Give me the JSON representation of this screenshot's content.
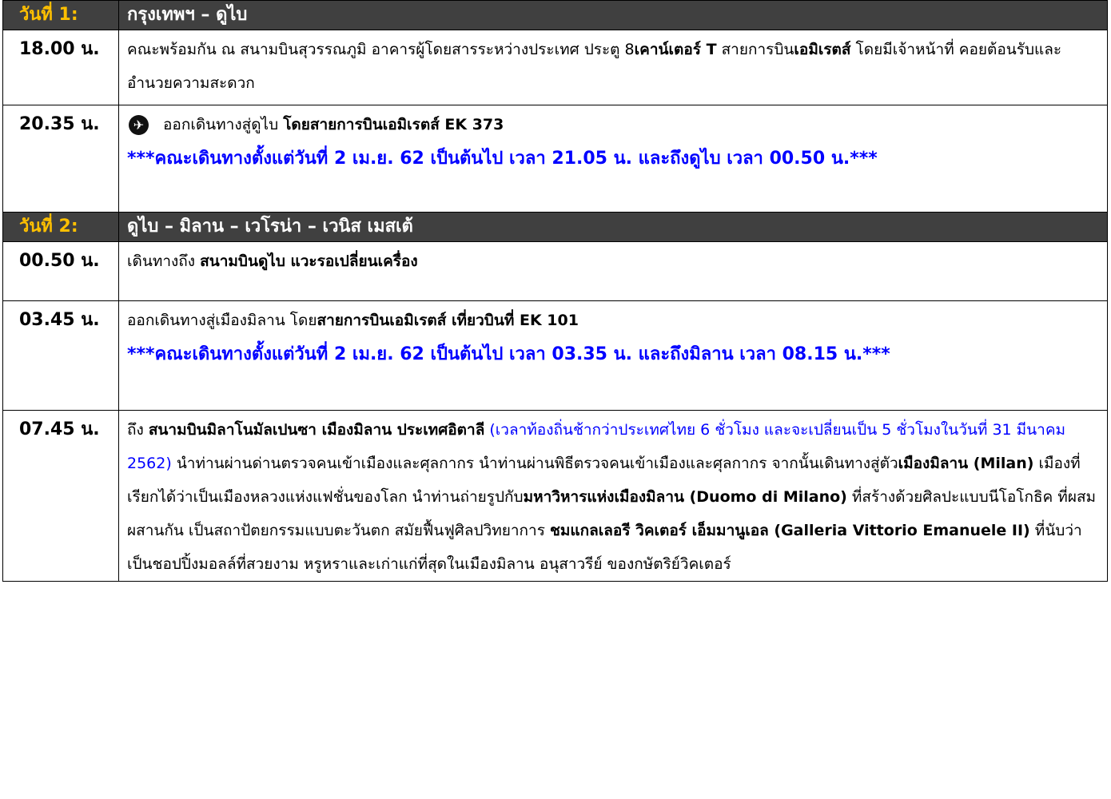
{
  "days": [
    {
      "label": "วันที่ 1:",
      "title": "กรุงเทพฯ – ดูไบ",
      "rows": [
        {
          "time": "18.00 น.",
          "parts": [
            "คณะพร้อมกัน ณ สนามบินสุวรรณภูมิ อาคารผู้โดยสารระหว่างประเทศ ประตู 8",
            "เคาน์เตอร์ T",
            " สายการบิน",
            "เอมิเรตส์",
            " โดยมีเจ้าหน้าที่ คอยต้อนรับและอำนวยความสะดวก"
          ]
        },
        {
          "time": "20.35 น.",
          "icon": "airplane-departure-icon",
          "parts": [
            "ออกเดินทางสู่ดูไบ ",
            "โดยสายการบินเอมิเรตส์ EK 373"
          ],
          "notice": "***คณะเดินทางตั้งแต่วันที่ 2 เม.ย. 62 เป็นต้นไป เวลา 21.05 น. และถึงดูไบ เวลา 00.50 น.***"
        }
      ]
    },
    {
      "label": "วันที่ 2:",
      "title": "ดูไบ – มิลาน – เวโรน่า – เวนิส เมสเต้",
      "rows": [
        {
          "time": "00.50 น.",
          "parts": [
            " เดินทางถึง ",
            "สนามบินดูไบ แวะรอเปลี่ยนเครื่อง"
          ]
        },
        {
          "time": "03.45 น.",
          "parts": [
            "ออกเดินทางสู่เมืองมิลาน โดย",
            "สายการบินเอมิเรตส์ เที่ยวบินที่ EK 101"
          ],
          "notice": "***คณะเดินทางตั้งแต่วันที่ 2 เม.ย. 62 เป็นต้นไป เวลา 03.35 น. และถึงมิลาน เวลา 08.15 น.***"
        },
        {
          "time": "07.45 น.",
          "parts": [
            "ถึง ",
            "สนามบินมิลาโนมัลเปนซา เมืองมิลาน ประเทศอิตาลี",
            " (เวลาท้องถิ่นช้ากว่าประเทศไทย 6 ชั่วโมง และจะเปลี่ยนเป็น 5 ชั่วโมงในวันที่ 31 มีนาคม 2562)",
            " นำท่านผ่านด่านตรวจคนเข้าเมืองและศุลกากร นำท่านผ่านพิธีตรวจคนเข้าเมืองและศุลกากร จากนั้นเดินทางสู่ตัว",
            "เมืองมิลาน (Milan)",
            " เมืองที่เรียกได้ว่าเป็นเมืองหลวงแห่งแฟชั่นของโลก นำท่านถ่ายรูปกับ",
            "มหาวิหารแห่งเมืองมิลาน (Duomo di Milano)",
            " ที่สร้างด้วยศิลปะแบบนีโอโกธิค ที่ผสมผสานกัน เป็นสถาปัตยกรรมแบบตะวันตก สมัยฟื้นฟูศิลปวิทยาการ ",
            "ชมแกลเลอรี วิคเตอร์ เอ็มมานูเอล (Galleria Vittorio Emanuele II)",
            " ที่นับว่าเป็นชอปปิ้งมอลล์ที่สวยงาม หรูหราและเก่าแก่ที่สุดในเมืองมิลาน อนุสาวรีย์ ของกษัตริย์วิคเตอร์"
          ]
        }
      ]
    }
  ]
}
